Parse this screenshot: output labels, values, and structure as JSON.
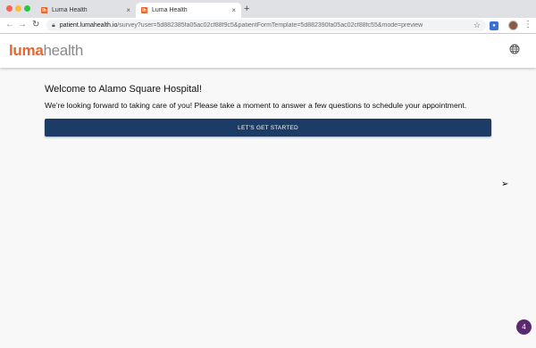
{
  "browser": {
    "tabs": [
      {
        "favicon": "lh",
        "title": "Luma Health",
        "close": "×"
      },
      {
        "favicon": "lh",
        "title": "Luma Health",
        "close": "×"
      }
    ],
    "new_tab": "+",
    "url_host": "patient.lumahealth.io",
    "url_rest": "/survey?user=5d882385fa05ac02cf88f9c5&patientFormTemplate=5d882390fa05ac02cf88fc55&mode=preview"
  },
  "header": {
    "logo_luma": "luma",
    "logo_health": "health",
    "language_icon": "globe-icon"
  },
  "main": {
    "welcome": "Welcome to Alamo Square Hospital!",
    "subtitle": "We’re looking forward to taking care of you! Please take a moment to answer a few questions to schedule your appointment.",
    "start_button": "LET’S GET STARTED"
  },
  "badge": {
    "count": "4"
  },
  "colors": {
    "brand_orange": "#e8652b",
    "button_navy": "#1c3c66",
    "badge_purple": "#5b2a6e"
  }
}
